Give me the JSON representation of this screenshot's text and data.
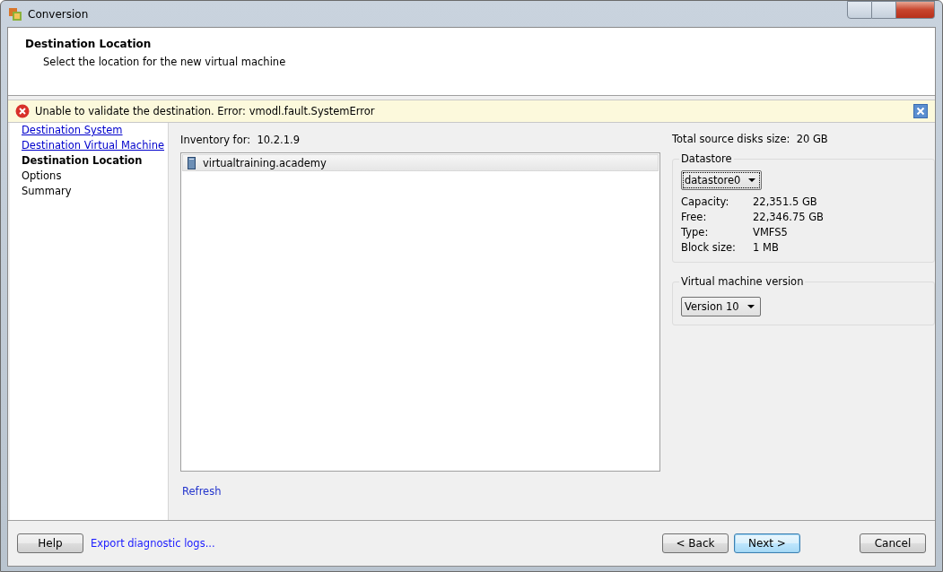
{
  "window": {
    "title": "Conversion"
  },
  "header": {
    "title": "Destination Location",
    "subtitle": "Select the location for the new virtual machine"
  },
  "error": {
    "message": "Unable to validate the destination. Error: vmodl.fault.SystemError"
  },
  "steps": [
    {
      "label": "Destination System",
      "kind": "link"
    },
    {
      "label": "Destination Virtual Machine",
      "kind": "link"
    },
    {
      "label": "Destination Location",
      "kind": "current"
    },
    {
      "label": "Options",
      "kind": "pending"
    },
    {
      "label": "Summary",
      "kind": "pending"
    }
  ],
  "inventory": {
    "label": "Inventory for:",
    "host": "10.2.1.9",
    "items": [
      {
        "label": "virtualtraining.academy",
        "selected": true
      }
    ],
    "refresh": "Refresh"
  },
  "disks": {
    "label": "Total source disks size:",
    "value": "20 GB"
  },
  "datastore": {
    "title": "Datastore",
    "selection": "datastore0",
    "fields": [
      {
        "label": "Capacity:",
        "value": "22,351.5 GB"
      },
      {
        "label": "Free:",
        "value": "22,346.75 GB"
      },
      {
        "label": "Type:",
        "value": "VMFS5"
      },
      {
        "label": "Block size:",
        "value": "1 MB"
      }
    ]
  },
  "vm_version": {
    "title": "Virtual machine version",
    "selection": "Version 10"
  },
  "footer": {
    "help": "Help",
    "export": "Export diagnostic logs...",
    "back": "< Back",
    "next": "Next >",
    "cancel": "Cancel"
  }
}
